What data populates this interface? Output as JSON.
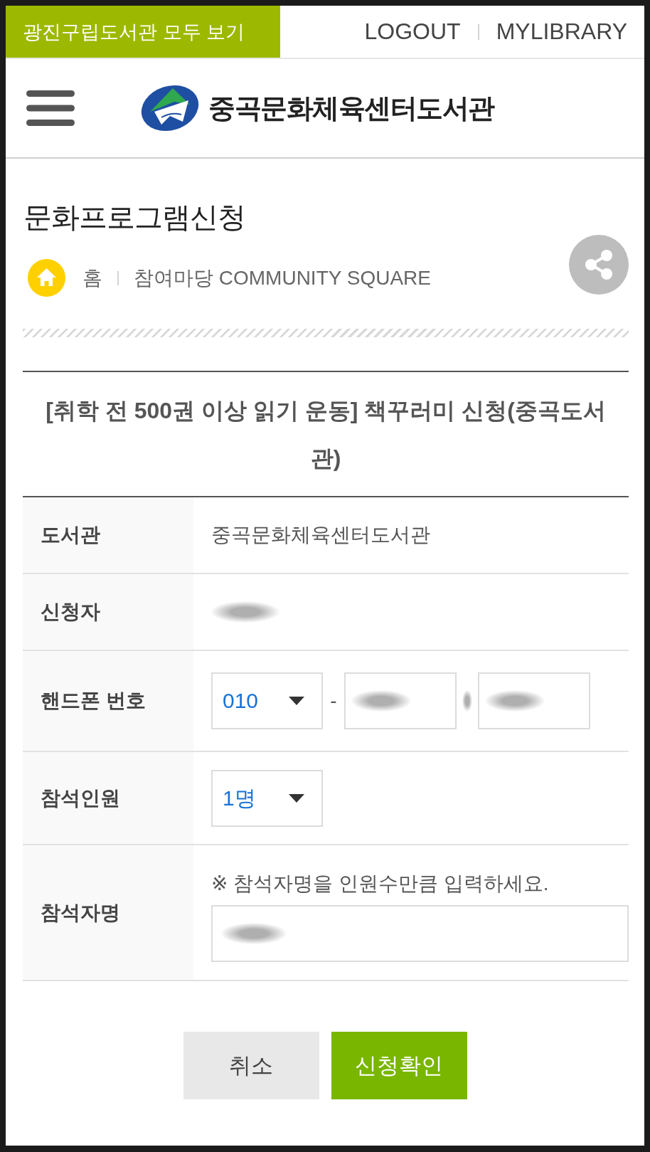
{
  "top_bar": {
    "all_libraries_link": "광진구립도서관 모두 보기",
    "links": [
      "LOGOUT",
      "MYLIBRARY"
    ]
  },
  "header": {
    "logo_text": "중곡문화체육센터도서관"
  },
  "page": {
    "title": "문화프로그램신청",
    "breadcrumb": [
      "홈",
      "참여마당 COMMUNITY SQUARE"
    ]
  },
  "program_title": "[취학 전 500권 이상 읽기 운동] 책꾸러미 신청(중곡도서관)",
  "form": {
    "rows": [
      {
        "kind": "text",
        "label": "도서관",
        "value": "중곡문화체육센터도서관",
        "blurred": false
      },
      {
        "kind": "text",
        "label": "신청자",
        "blurred": true
      },
      {
        "kind": "phone",
        "label": "핸드폰 번호",
        "select": "010",
        "separators": [
          {
            "text": "-",
            "blurred": false
          },
          {
            "blurred": true
          }
        ],
        "inputs": [
          {
            "blurred": true
          },
          {
            "blurred": true
          }
        ]
      },
      {
        "kind": "select",
        "label": "참석인원",
        "select": "1명"
      },
      {
        "kind": "names",
        "label": "참석자명",
        "note": "※ 참석자명을 인원수만큼 입력하세요.",
        "inputs": [
          {
            "blurred": true
          }
        ]
      }
    ]
  },
  "buttons": [
    {
      "kind": "cancel",
      "label": "취소"
    },
    {
      "kind": "submit",
      "label": "신청확인"
    }
  ]
}
